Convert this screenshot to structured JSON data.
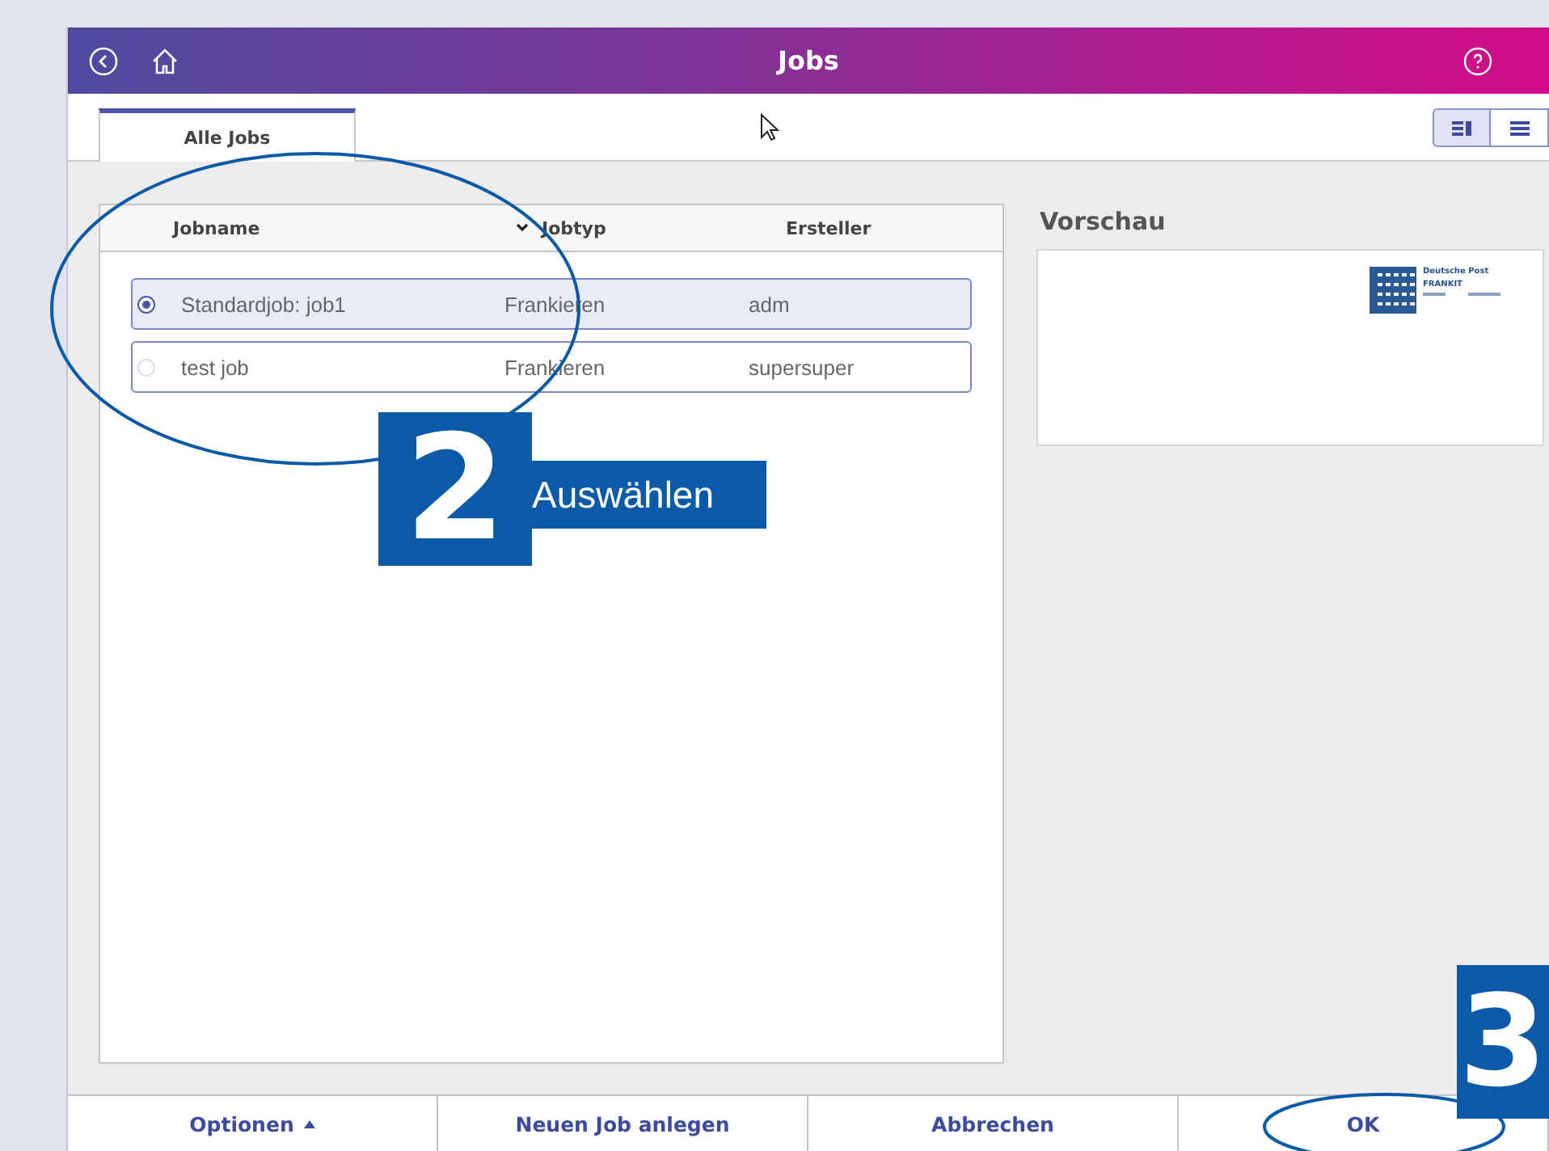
{
  "window": {
    "title": "Jobs"
  },
  "tabs": [
    {
      "label": "Alle Jobs",
      "selected": true
    }
  ],
  "view_toggle": [
    {
      "kind": "split",
      "selected": true
    },
    {
      "kind": "list",
      "selected": false
    }
  ],
  "table": {
    "columns": [
      "Jobname",
      "Jobtyp",
      "Ersteller"
    ],
    "rows": [
      {
        "name": "Standardjob: job1",
        "type": "Frankieren",
        "creator": "adm",
        "selected": true
      },
      {
        "name": "test job",
        "type": "Frankieren",
        "creator": "supersuper",
        "selected": false
      }
    ]
  },
  "preview": {
    "title": "Vorschau",
    "stamp": {
      "carrier": "Deutsche Post",
      "label": "FRANKIT"
    }
  },
  "buttons": [
    {
      "label": "Optionen",
      "kind": "menu"
    },
    {
      "label": "Neuen Job anlegen",
      "kind": "plain"
    },
    {
      "label": "Abbrechen",
      "kind": "plain"
    },
    {
      "label": "OK",
      "kind": "plain"
    }
  ],
  "annotations": [
    {
      "number": "2",
      "text": "Auswählen"
    },
    {
      "number": "3"
    }
  ]
}
